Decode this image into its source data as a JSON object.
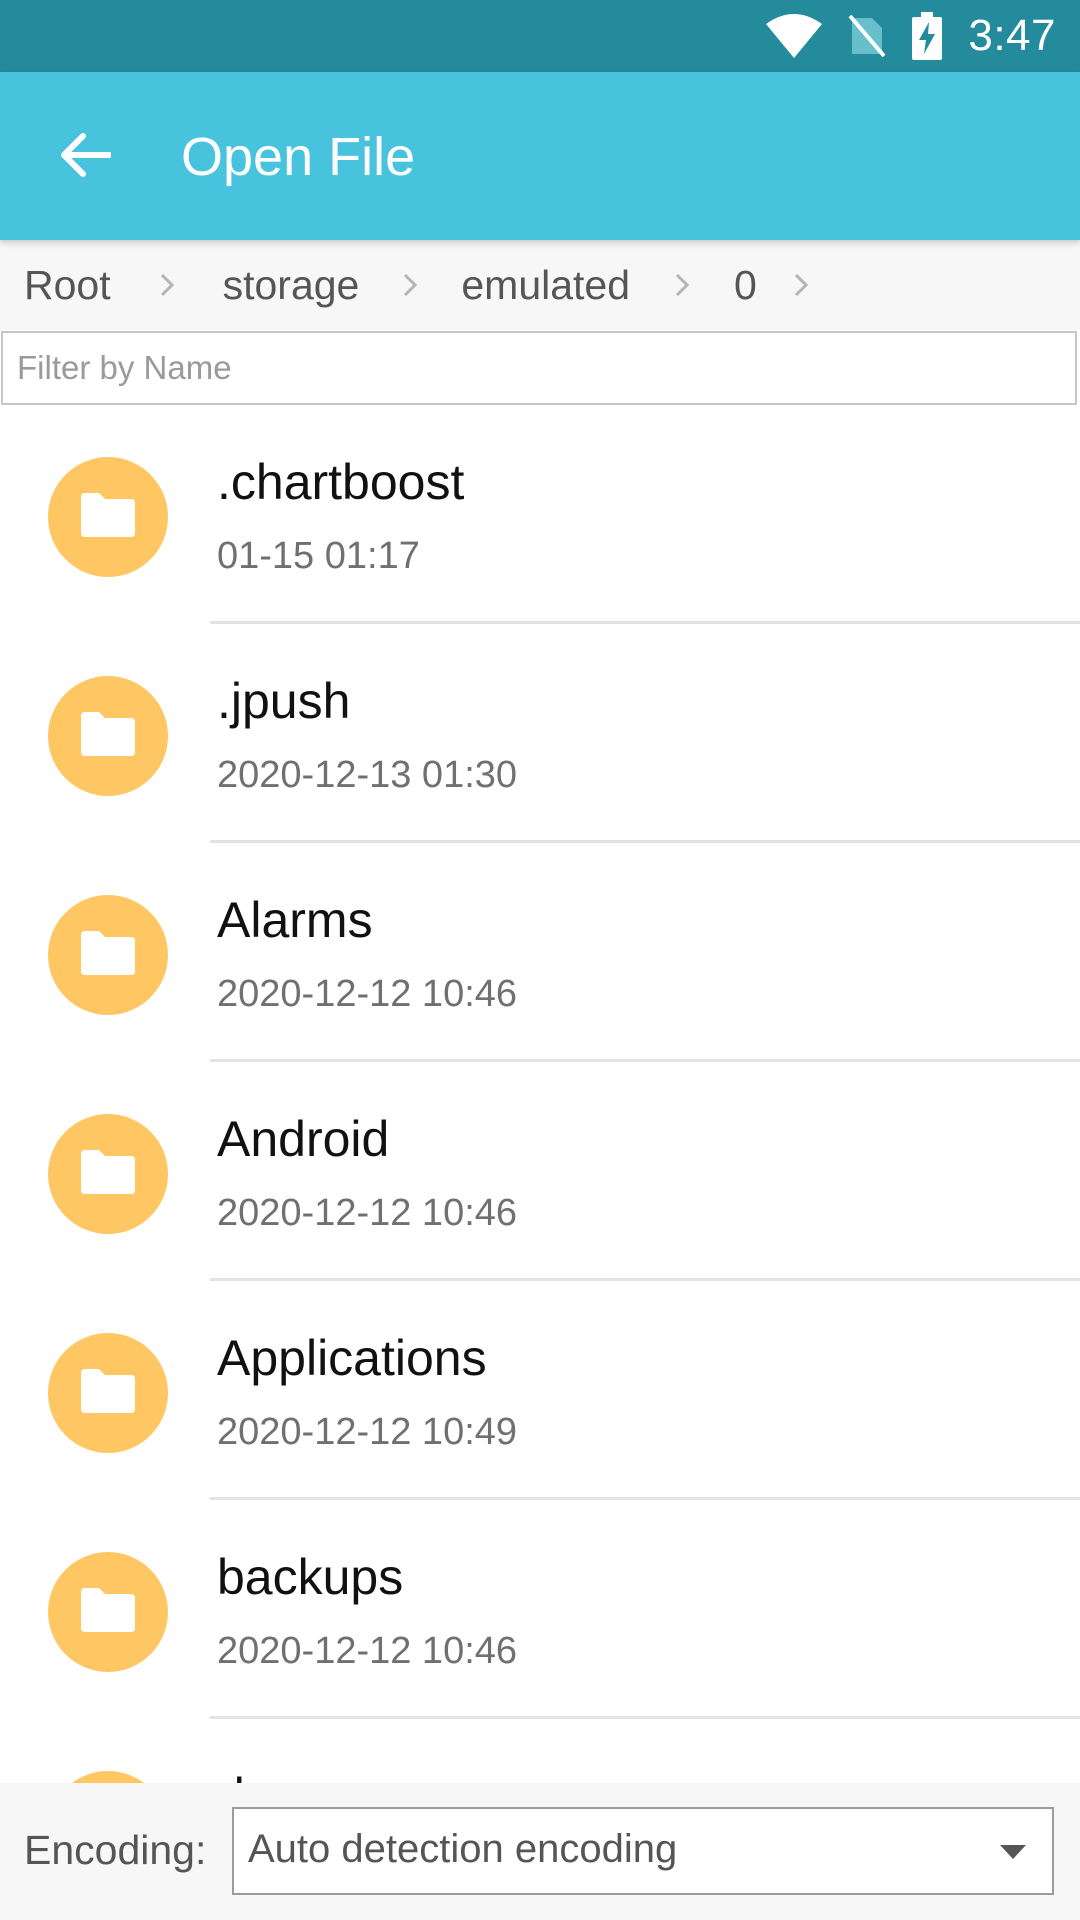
{
  "status_bar": {
    "time": "3:47"
  },
  "app_bar": {
    "title": "Open File"
  },
  "breadcrumb": [
    "Root",
    "storage",
    "emulated",
    "0"
  ],
  "filter": {
    "placeholder": "Filter by Name",
    "value": ""
  },
  "files": [
    {
      "name": ".chartboost",
      "date": "01-15 01:17"
    },
    {
      "name": ".jpush",
      "date": "2020-12-13 01:30"
    },
    {
      "name": "Alarms",
      "date": "2020-12-12 10:46"
    },
    {
      "name": "Android",
      "date": "2020-12-12 10:46"
    },
    {
      "name": "Applications",
      "date": "2020-12-12 10:49"
    },
    {
      "name": "backups",
      "date": "2020-12-12 10:46"
    },
    {
      "name": "d",
      "date": ""
    }
  ],
  "encoding": {
    "label": "Encoding:",
    "value": "Auto detection encoding"
  },
  "colors": {
    "status_bar": "#238b9b",
    "app_bar": "#47c3dd",
    "folder_avatar": "#ffc763"
  },
  "icons": {
    "back": "arrow-left-icon",
    "folder": "folder-icon",
    "breadcrumb_separator": "chevron-right-icon",
    "dropdown": "triangle-down-icon"
  }
}
